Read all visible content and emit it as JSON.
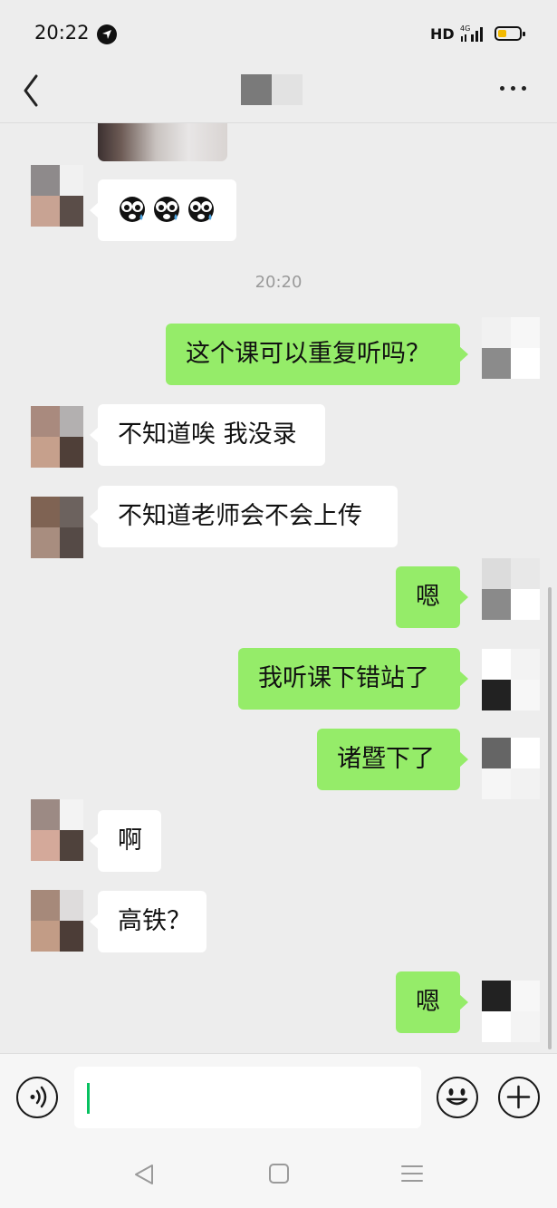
{
  "status_bar": {
    "time": "20:22",
    "network_label": "HD",
    "network_type": "4G",
    "battery_color": "#f2b900"
  },
  "header": {
    "back_icon": "chevron-left-icon",
    "more_icon": "more-dots-icon"
  },
  "chat": {
    "timestamp": "20:20",
    "emoji_row": [
      "crying-face-emoji",
      "crying-face-emoji",
      "crying-face-emoji"
    ],
    "messages": [
      {
        "side": "right",
        "text": "这个课可以重复听吗？"
      },
      {
        "side": "left",
        "text": "不知道唉 我没录"
      },
      {
        "side": "left",
        "text": "不知道老师会不会上传"
      },
      {
        "side": "right",
        "text": "嗯"
      },
      {
        "side": "right",
        "text": "我听课下错站了"
      },
      {
        "side": "right",
        "text": "诸暨下了"
      },
      {
        "side": "left",
        "text": "啊"
      },
      {
        "side": "left",
        "text": "高铁？"
      },
      {
        "side": "right",
        "text": "嗯"
      }
    ]
  },
  "input_bar": {
    "voice_icon": "voice-icon",
    "emoji_icon": "smiley-icon",
    "plus_icon": "plus-icon",
    "value": ""
  },
  "colors": {
    "background": "#ededed",
    "bubble_sent": "#95ec69",
    "bubble_received": "#ffffff",
    "caret": "#07c160"
  }
}
